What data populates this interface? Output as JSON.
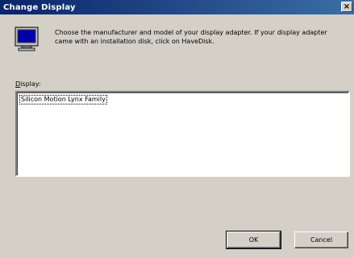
{
  "window": {
    "title": "Change Display",
    "close_glyph": "×"
  },
  "header": {
    "icon": "monitor-icon",
    "instructions": "Choose the manufacturer and model of your display adapter.  If your display adapter came with an installation disk, click on HaveDisk."
  },
  "display": {
    "label_accel": "D",
    "label_rest": "isplay:",
    "items": [
      "Silicon Motion Lynx Family"
    ]
  },
  "buttons": {
    "ok_label": "OK",
    "cancel_label": "Cancel"
  },
  "colors": {
    "face": "#d4d0c8",
    "title_start": "#0a246a",
    "title_end": "#3a6ea5",
    "monitor_screen": "#0000aa"
  }
}
